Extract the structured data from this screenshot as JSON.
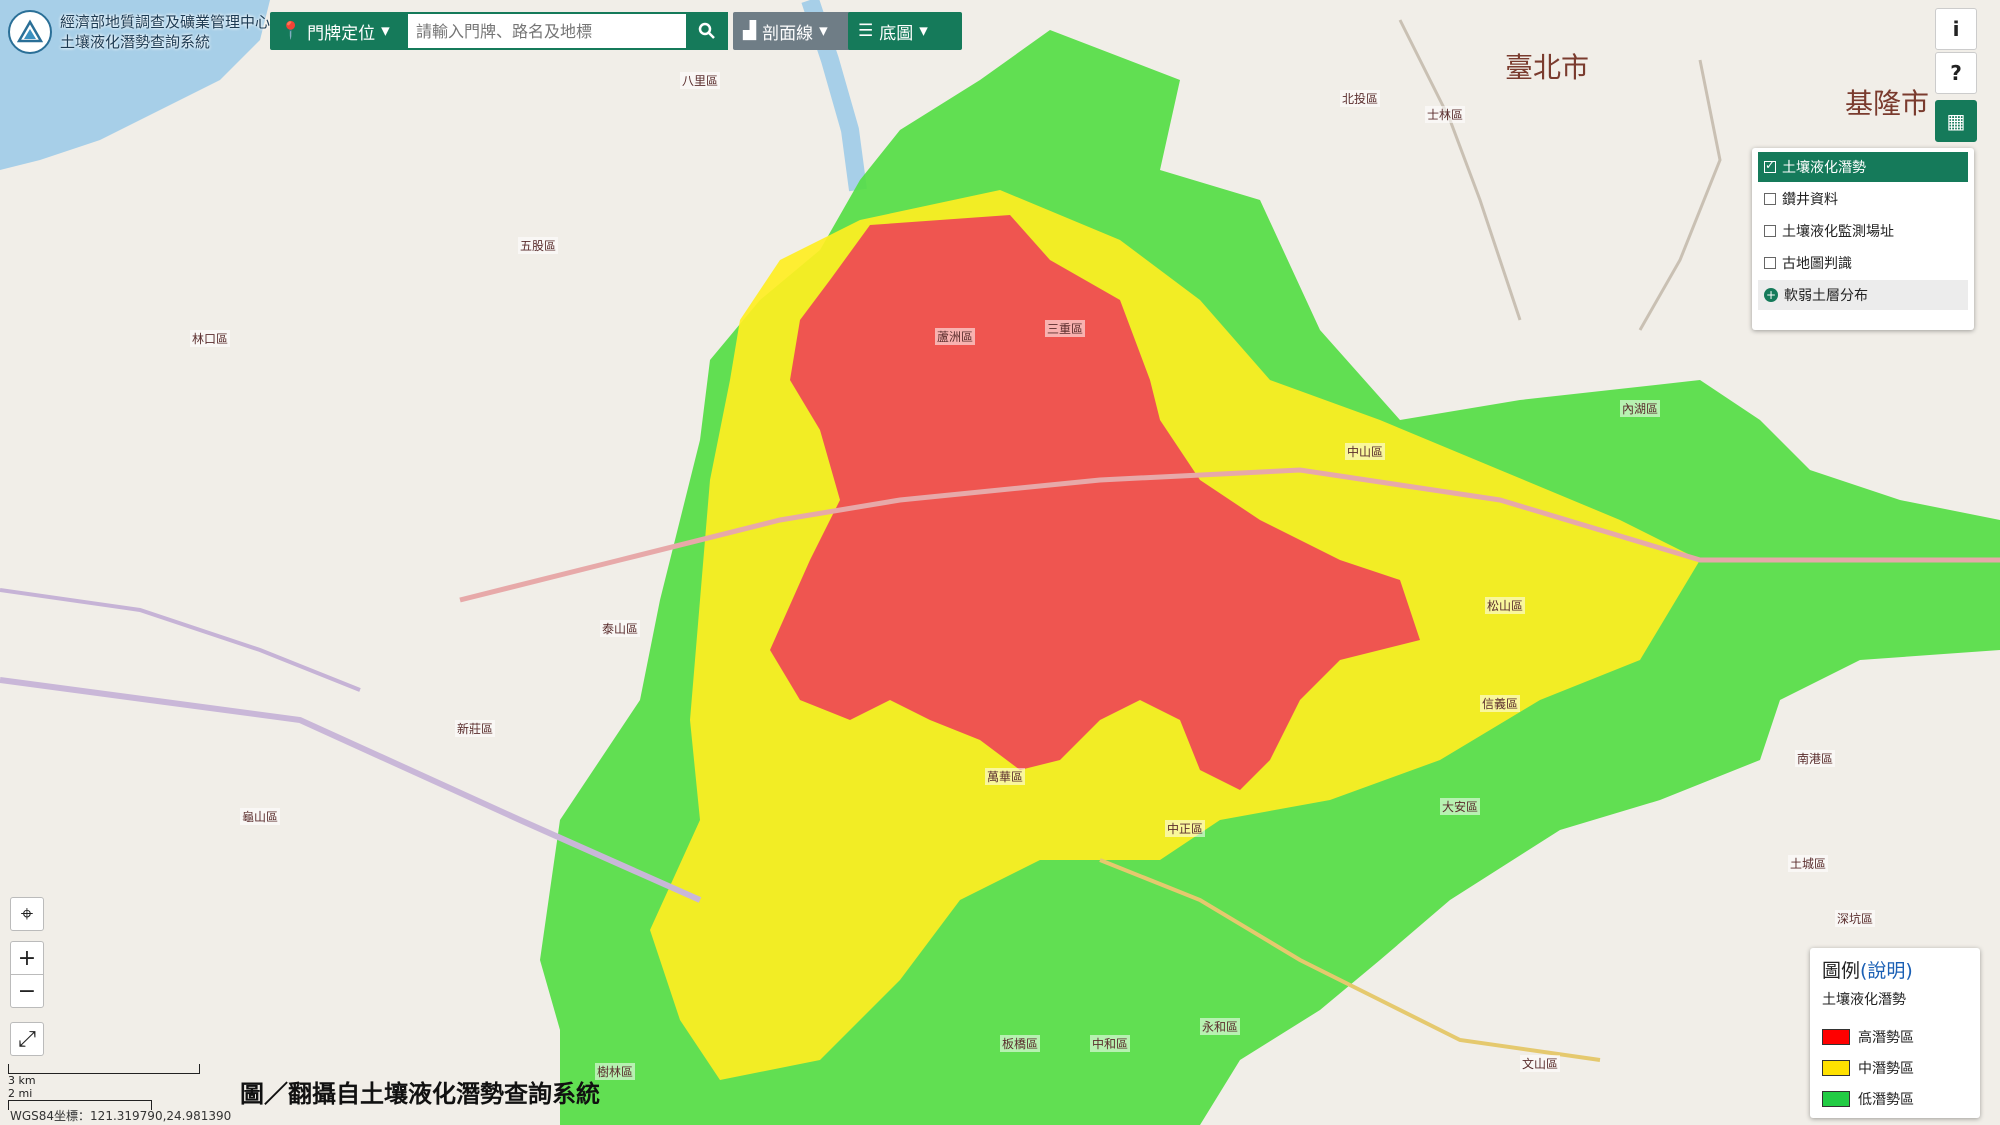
{
  "header": {
    "org_name": "經濟部地質調查及礦業管理中心",
    "system_name": "土壤液化潛勢查詢系統"
  },
  "toolbar": {
    "locate_label": "門牌定位",
    "search_placeholder": "請輸入門牌、路名及地標",
    "profile_label": "剖面線",
    "basemap_label": "底圖"
  },
  "right_buttons": {
    "info": "i",
    "help": "?"
  },
  "layers": [
    {
      "label": "土壤液化潛勢",
      "checked": true
    },
    {
      "label": "鑽井資料",
      "checked": false
    },
    {
      "label": "土壤液化監測場址",
      "checked": false
    },
    {
      "label": "古地圖判識",
      "checked": false
    },
    {
      "label": "軟弱土層分布",
      "expandable": true
    }
  ],
  "legend": {
    "title": "圖例",
    "link": "(說明)",
    "subtitle": "土壤液化潛勢",
    "items": [
      {
        "label": "高潛勢區",
        "color": "#ff0000"
      },
      {
        "label": "中潛勢區",
        "color": "#ffe100"
      },
      {
        "label": "低潛勢區",
        "color": "#22cc44"
      }
    ]
  },
  "map": {
    "city_labels": [
      "臺北市",
      "基隆市"
    ],
    "place_labels": [
      "蘆洲區",
      "三重區",
      "新莊區",
      "板橋區",
      "中和區",
      "永和區",
      "萬華區",
      "中正區",
      "大安區",
      "信義區",
      "松山區",
      "內湖區",
      "中山區",
      "士林區",
      "北投區",
      "五股區",
      "泰山區",
      "樹林區",
      "土城區",
      "南港區",
      "深坑區",
      "文山區",
      "八里區",
      "林口區",
      "龜山區"
    ],
    "zoom_in": "+",
    "zoom_out": "−",
    "scale_km": "3 km",
    "scale_mi": "2 mi",
    "coordinate": "WGS84坐標：121.319790,24.981390"
  },
  "caption": "圖／翻攝自土壤液化潛勢查詢系統"
}
